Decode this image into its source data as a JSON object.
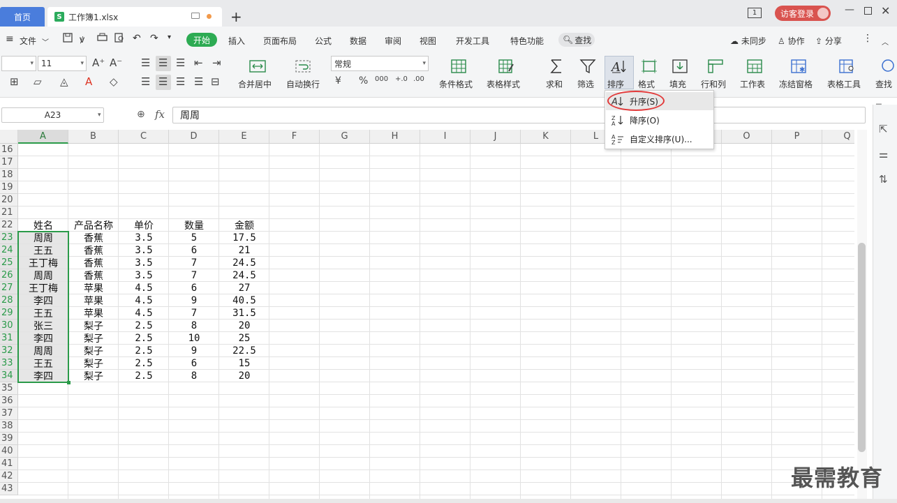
{
  "titlebar": {
    "home_tab": "首页",
    "file_tab": "工作簿1.xlsx",
    "login": "访客登录",
    "page_badge": "1"
  },
  "menubar": {
    "file_menu": "文件",
    "start": "开始",
    "items": [
      "插入",
      "页面布局",
      "公式",
      "数据",
      "审阅",
      "视图",
      "开发工具",
      "特色功能"
    ],
    "search": "查找",
    "sync": "未同步",
    "collab": "协作",
    "share": "分享"
  },
  "toolbar": {
    "font_size": "11",
    "number_format": "常规",
    "merge_center": "合并居中",
    "wrap_text": "自动换行",
    "cond_format": "条件格式",
    "table_style": "表格样式",
    "sum": "求和",
    "filter": "筛选",
    "sort": "排序",
    "format": "格式",
    "fill": "填充",
    "row_col": "行和列",
    "worksheet": "工作表",
    "freeze": "冻结窗格",
    "table_tools": "表格工具",
    "find": "查找",
    "currency_symbol": "¥",
    "percent": "%",
    "thousands": "000",
    "dec_inc": "+.0",
    "dec_dec": ".00"
  },
  "formula_bar": {
    "name_box": "A23",
    "fx": "fx",
    "value": "周周"
  },
  "sort_menu": {
    "ascending": "升序(S)",
    "descending": "降序(O)",
    "custom": "自定义排序(U)..."
  },
  "grid": {
    "columns": [
      "A",
      "B",
      "C",
      "D",
      "E",
      "F",
      "G",
      "H",
      "I",
      "J",
      "K",
      "L",
      "M",
      "N",
      "O",
      "P",
      "Q"
    ],
    "rows": [
      "16",
      "17",
      "18",
      "19",
      "20",
      "21",
      "22",
      "23",
      "24",
      "25",
      "26",
      "27",
      "28",
      "29",
      "30",
      "31",
      "32",
      "33",
      "34",
      "35",
      "36",
      "37",
      "38",
      "39",
      "40",
      "41",
      "42",
      "43"
    ],
    "header": [
      "姓名",
      "产品名称",
      "单价",
      "数量",
      "金额"
    ],
    "data": [
      [
        "周周",
        "香蕉",
        "3.5",
        "5",
        "17.5"
      ],
      [
        "王五",
        "香蕉",
        "3.5",
        "6",
        "21"
      ],
      [
        "王丁梅",
        "香蕉",
        "3.5",
        "7",
        "24.5"
      ],
      [
        "周周",
        "香蕉",
        "3.5",
        "7",
        "24.5"
      ],
      [
        "王丁梅",
        "苹果",
        "4.5",
        "6",
        "27"
      ],
      [
        "李四",
        "苹果",
        "4.5",
        "9",
        "40.5"
      ],
      [
        "王五",
        "苹果",
        "4.5",
        "7",
        "31.5"
      ],
      [
        "张三",
        "梨子",
        "2.5",
        "8",
        "20"
      ],
      [
        "李四",
        "梨子",
        "2.5",
        "10",
        "25"
      ],
      [
        "周周",
        "梨子",
        "2.5",
        "9",
        "22.5"
      ],
      [
        "王五",
        "梨子",
        "2.5",
        "6",
        "15"
      ],
      [
        "李四",
        "梨子",
        "2.5",
        "8",
        "20"
      ]
    ]
  },
  "watermark": "最需教育",
  "colors": {
    "accent_green": "#2dab53",
    "home_blue": "#4a7ddc",
    "login_red": "#d9534f",
    "ring_red": "#e23a3a"
  }
}
